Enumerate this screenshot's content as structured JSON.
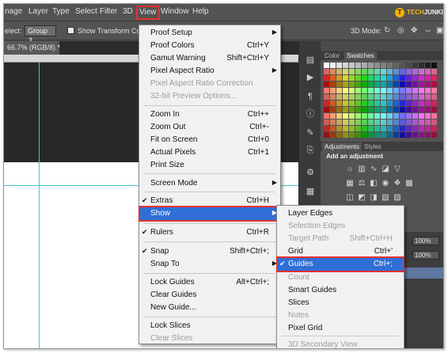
{
  "menubar": {
    "items": [
      "nage",
      "Layer",
      "Type",
      "Select",
      "Filter",
      "3D",
      "View",
      "Window",
      "Help"
    ],
    "active": "View"
  },
  "brand": {
    "logo_text_1": "TECH",
    "logo_text_2": "JUNKIE"
  },
  "options_bar": {
    "select_label": "elect:",
    "select_value": "Group",
    "transform_controls": "Show Transform Contr",
    "mode_label": "3D Mode:"
  },
  "document": {
    "tab": "66.7% (RGB/8) *",
    "guide_color": "#42c5d6"
  },
  "right_panel": {
    "tab_color": "Color",
    "tab_swatches": "Swatches",
    "tab_adjustments": "Adjustments",
    "tab_styles": "Styles",
    "adjust_heading": "Add an adjustment",
    "layers_pct1": "100%",
    "layers_pct2": "100%"
  },
  "view_menu": {
    "items": [
      {
        "label": "Proof Setup",
        "submenu": true
      },
      {
        "label": "Proof Colors",
        "shortcut": "Ctrl+Y"
      },
      {
        "label": "Gamut Warning",
        "shortcut": "Shift+Ctrl+Y"
      },
      {
        "label": "Pixel Aspect Ratio",
        "submenu": true
      },
      {
        "label": "Pixel Aspect Ratio Correction",
        "disabled": true
      },
      {
        "label": "32-bit Preview Options...",
        "disabled": true
      },
      {
        "label": "Zoom In",
        "shortcut": "Ctrl++"
      },
      {
        "label": "Zoom Out",
        "shortcut": "Ctrl+-"
      },
      {
        "label": "Fit on Screen",
        "shortcut": "Ctrl+0"
      },
      {
        "label": "Actual Pixels",
        "shortcut": "Ctrl+1"
      },
      {
        "label": "Print Size"
      },
      {
        "label": "Screen Mode",
        "submenu": true
      },
      {
        "label": "Extras",
        "shortcut": "Ctrl+H",
        "checked": true
      },
      {
        "label": "Show",
        "submenu": true,
        "highlighted": true
      },
      {
        "label": "Rulers",
        "shortcut": "Ctrl+R",
        "checked": true
      },
      {
        "label": "Snap",
        "shortcut": "Shift+Ctrl+;",
        "checked": true
      },
      {
        "label": "Snap To",
        "submenu": true
      },
      {
        "label": "Lock Guides",
        "shortcut": "Alt+Ctrl+;"
      },
      {
        "label": "Clear Guides"
      },
      {
        "label": "New Guide..."
      },
      {
        "label": "Lock Slices"
      },
      {
        "label": "Clear Slices",
        "disabled": true
      }
    ]
  },
  "show_submenu": {
    "items": [
      {
        "label": "Layer Edges"
      },
      {
        "label": "Selection Edges",
        "disabled": true
      },
      {
        "label": "Target Path",
        "shortcut": "Shift+Ctrl+H",
        "disabled": true
      },
      {
        "label": "Grid",
        "shortcut": "Ctrl+'"
      },
      {
        "label": "Guides",
        "shortcut": "Ctrl+;",
        "checked": true,
        "highlighted": true
      },
      {
        "label": "Count",
        "disabled": true
      },
      {
        "label": "Smart Guides"
      },
      {
        "label": "Slices"
      },
      {
        "label": "Notes",
        "disabled": true
      },
      {
        "label": "Pixel Grid"
      },
      {
        "label": "3D Secondary View",
        "disabled": true
      }
    ]
  },
  "colors": {
    "highlight": "#2f6fd6",
    "annotation_red": "#e53030",
    "menu_bg": "#f1f1f1",
    "chrome_dark": "#535353"
  }
}
